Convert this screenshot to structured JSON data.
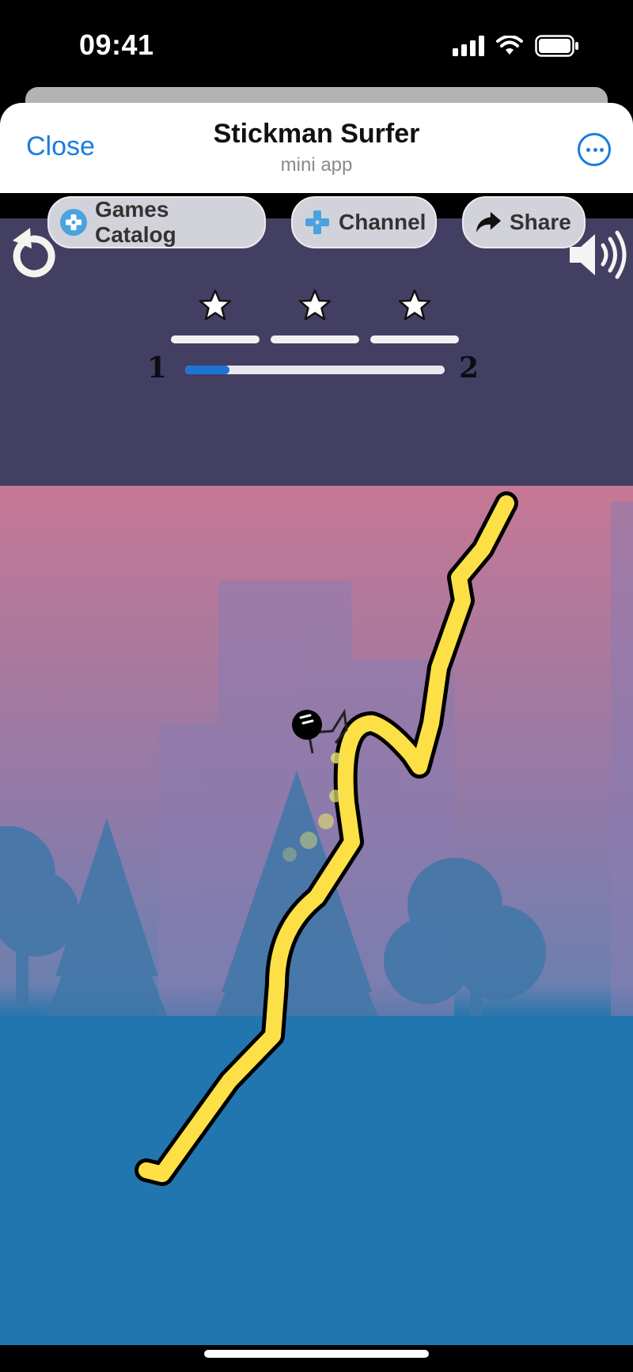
{
  "status_bar": {
    "time": "09:41",
    "icons": [
      "signal-icon",
      "wifi-icon",
      "battery-icon"
    ]
  },
  "header": {
    "close_label": "Close",
    "title": "Stickman Surfer",
    "subtitle": "mini app",
    "more_icon": "more-icon"
  },
  "toolbar": {
    "games_catalog": "Games Catalog",
    "channel": "Channel",
    "share": "Share"
  },
  "game": {
    "stars": 3,
    "current_level": "1",
    "next_level": "2",
    "level_progress": 0.17,
    "colors": {
      "panel": "#433f62",
      "sky_top": "#c67894",
      "water": "#2276b0",
      "track": "#fde046",
      "progress": "#1d74d3"
    }
  }
}
